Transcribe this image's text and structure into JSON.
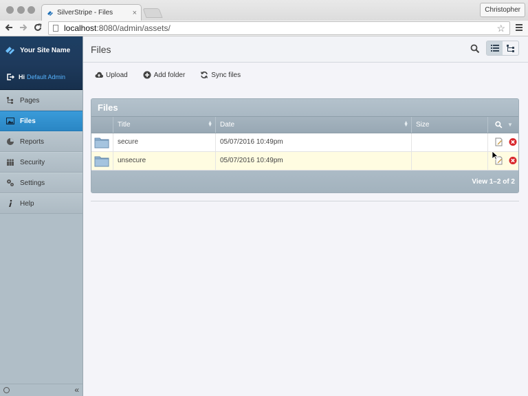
{
  "browser": {
    "tab_title": "SilverStripe - Files",
    "tab_close": "×",
    "profile_name": "Christopher",
    "url_host": "localhost",
    "url_rest": ":8080/admin/assets/"
  },
  "sidebar": {
    "site_name": "Your Site Name",
    "greeting": "Hi",
    "user_name": "Default Admin",
    "items": [
      {
        "label": "Pages",
        "icon": "sitetree-icon",
        "active": false
      },
      {
        "label": "Files",
        "icon": "image-icon",
        "active": true
      },
      {
        "label": "Reports",
        "icon": "pie-chart-icon",
        "active": false
      },
      {
        "label": "Security",
        "icon": "users-icon",
        "active": false
      },
      {
        "label": "Settings",
        "icon": "gears-icon",
        "active": false
      },
      {
        "label": "Help",
        "icon": "info-icon",
        "active": false
      }
    ],
    "collapse_label": "«"
  },
  "header": {
    "title": "Files"
  },
  "actions": {
    "upload": "Upload",
    "add_folder": "Add folder",
    "sync_files": "Sync files"
  },
  "grid": {
    "title": "Files",
    "columns": [
      "Title",
      "Date",
      "Size"
    ],
    "rows": [
      {
        "title": "secure",
        "date": "05/07/2016 10:49pm",
        "size": ""
      },
      {
        "title": "unsecure",
        "date": "05/07/2016 10:49pm",
        "size": ""
      }
    ],
    "pagination": "View 1–2 of 2"
  },
  "colors": {
    "accent": "#2a86c4",
    "brand_bg": "#1e3a5c",
    "highlight_row": "#fffce1"
  }
}
